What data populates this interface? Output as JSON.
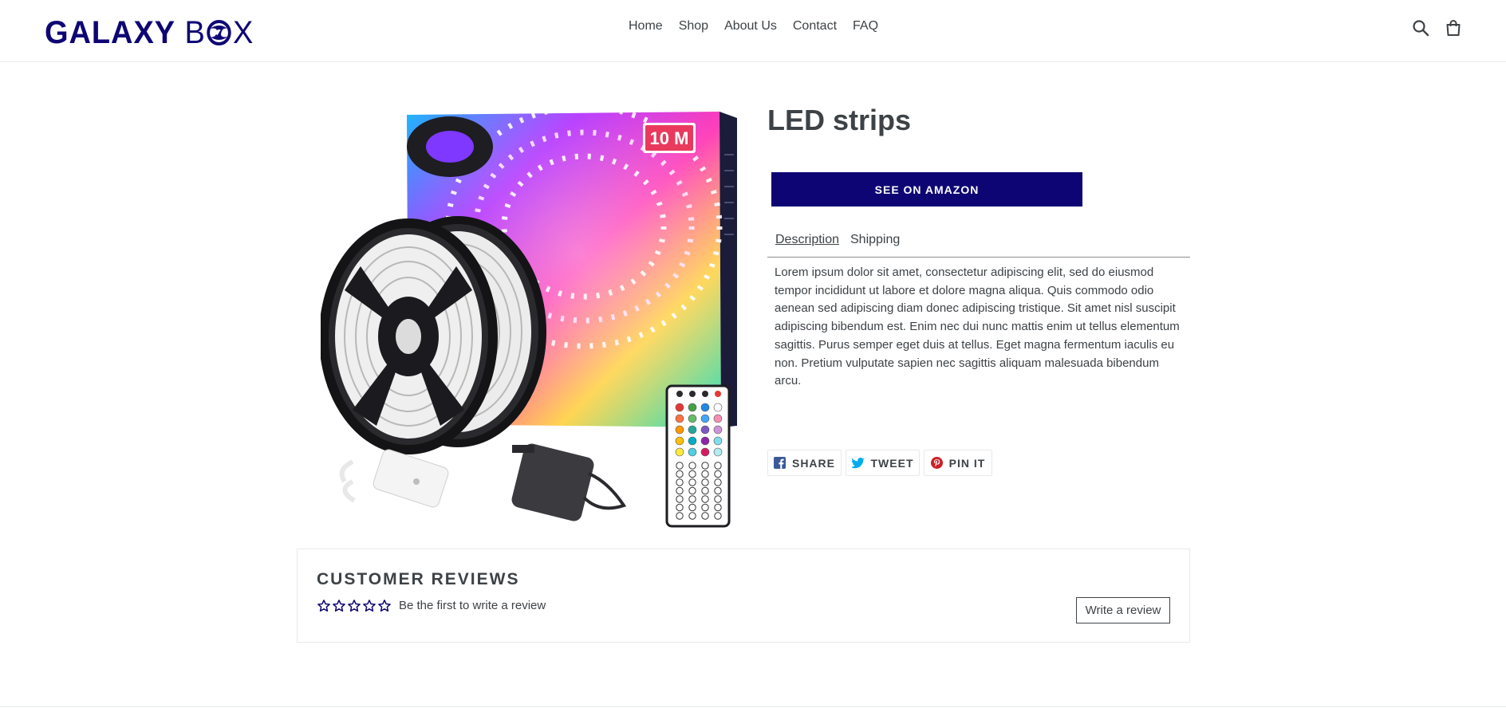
{
  "brand": {
    "word1": "GALAXY",
    "word2_start": "B",
    "word2_end": "X",
    "color": "#0e0574"
  },
  "nav": {
    "items": [
      "Home",
      "Shop",
      "About Us",
      "Contact",
      "FAQ"
    ]
  },
  "header_icons": [
    "search-icon",
    "cart-icon"
  ],
  "product": {
    "title": "LED strips",
    "button_label": "SEE ON AMAZON",
    "image": {
      "badge": "10 M"
    },
    "tabs": [
      "Description",
      "Shipping"
    ],
    "active_tab": "Description",
    "description": "Lorem ipsum dolor sit amet, consectetur adipiscing elit, sed do eiusmod tempor incididunt ut labore et dolore magna aliqua. Quis commodo odio aenean sed adipiscing diam donec adipiscing tristique. Sit amet nisl suscipit adipiscing bibendum est. Enim nec dui nunc mattis enim ut tellus elementum sagittis. Purus semper eget duis at tellus. Eget magna fermentum iaculis eu non. Pretium vulputate sapien nec sagittis aliquam malesuada bibendum arcu."
  },
  "share": [
    {
      "label": "SHARE",
      "icon": "facebook-icon"
    },
    {
      "label": "TWEET",
      "icon": "twitter-icon"
    },
    {
      "label": "PIN IT",
      "icon": "pinterest-icon"
    }
  ],
  "reviews": {
    "title": "CUSTOMER REVIEWS",
    "rating_stars_filled": 0,
    "rating_stars_total": 5,
    "empty_text": "Be the first to write a review",
    "write_button": "Write a review"
  },
  "colors": {
    "accent": "#0e0574",
    "text": "#3d4246",
    "border": "#e8e9eb",
    "facebook": "#3b5998",
    "twitter": "#00aced",
    "pinterest": "#cb2027"
  }
}
